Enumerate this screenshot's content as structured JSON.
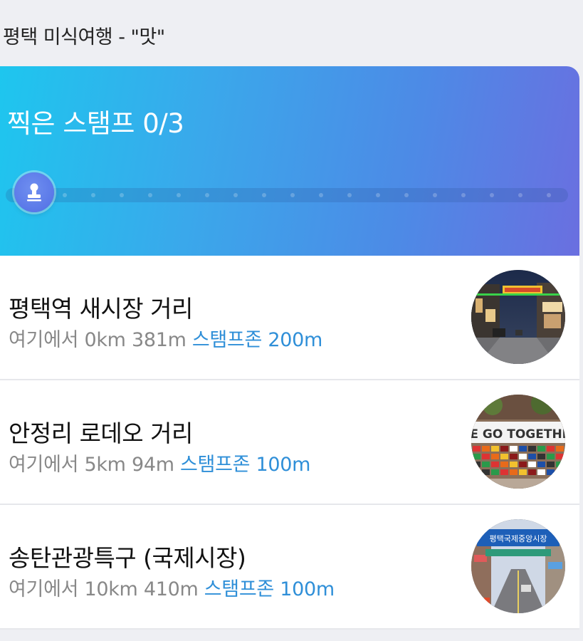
{
  "page": {
    "title": "평택 미식여행 - \"맛\""
  },
  "stamp_card": {
    "label": "찍은 스탬프 0/3",
    "collected": 0,
    "total": 3,
    "gradient_start": "#1ec6ee",
    "gradient_end": "#6a6fe0",
    "icon": "stamp-icon"
  },
  "spots": [
    {
      "name": "평택역 새시장 거리",
      "distance_prefix": "여기에서 0km 381m",
      "zone_text": "스탬프존 200m",
      "photo_icon": "street-photo"
    },
    {
      "name": "안정리 로데오 거리",
      "distance_prefix": "여기에서 5km 94m",
      "zone_text": "스탬프존 100m",
      "photo_icon": "flags-wall-photo",
      "photo_caption": "WE GO TOGETHER"
    },
    {
      "name": "송탄관광특구 (국제시장)",
      "distance_prefix": "여기에서 10km 410m",
      "zone_text": "스탬프존 100m",
      "photo_icon": "market-gate-photo",
      "photo_caption": "평택국제중앙시장"
    }
  ],
  "colors": {
    "zone_link": "#2f8fd8",
    "meta_gray": "#888888"
  }
}
